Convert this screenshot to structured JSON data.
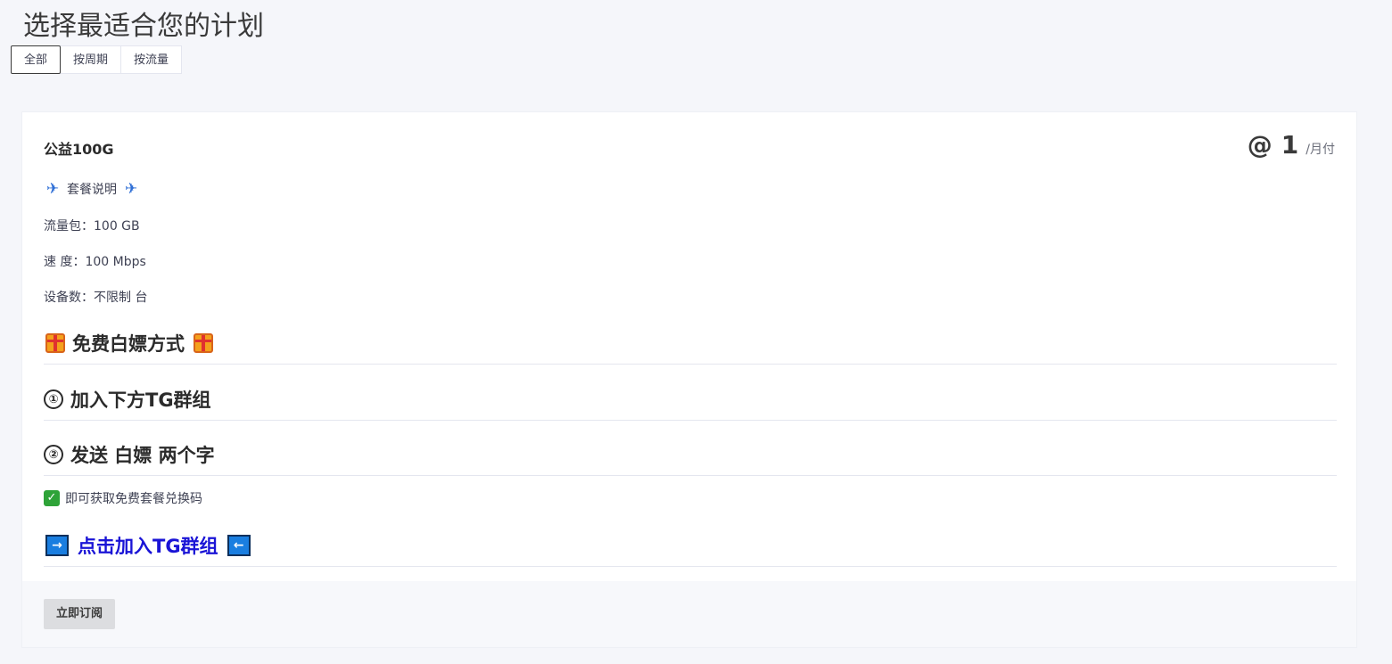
{
  "page": {
    "title": "选择最适合您的计划"
  },
  "tabs": [
    {
      "label": "全部",
      "active": true
    },
    {
      "label": "按周期",
      "active": false
    },
    {
      "label": "按流量",
      "active": false
    }
  ],
  "plan": {
    "name": "公益100G",
    "price_symbol": "@",
    "price_amount": "1",
    "price_unit": "/月付",
    "description_title": "套餐说明",
    "traffic": "流量包：100 GB",
    "speed": "速 度：100 Mbps",
    "devices": "设备数：不限制 台",
    "free_heading": "免费白嫖方式",
    "step1_num": "①",
    "step1": "加入下方TG群组",
    "step2_num": "②",
    "step2": "发送 白嫖 两个字",
    "result": "即可获取免费套餐兑换码",
    "join_link": "点击加入TG群组",
    "subscribe_label": "立即订阅"
  },
  "icons": {
    "airplane": "airplane-icon",
    "gift": "gift-icon",
    "check": "check-mark-icon",
    "arrow_right": "arrow-right-icon",
    "arrow_left": "arrow-left-icon"
  },
  "colors": {
    "background": "#f5f6fa",
    "link": "#1a14d6",
    "check": "#2ea338",
    "gift": "#f4a11c",
    "arrow_box": "#1a7ee0"
  }
}
